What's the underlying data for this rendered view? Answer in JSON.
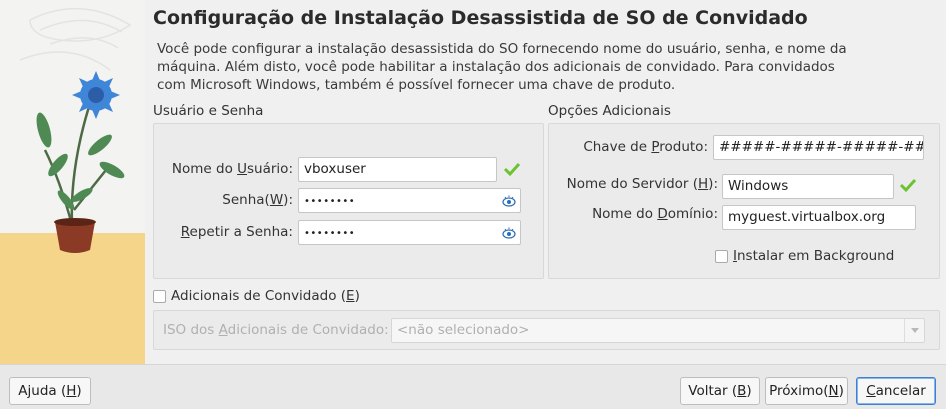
{
  "title": "Configuração de Instalação Desassistida de SO de Convidado",
  "description": "Você pode configurar a instalação desassistida do SO fornecendo nome do usuário, senha, e nome da máquina. Além disto, você pode habilitar a instalação dos adicionais de convidado. Para convidados com Microsoft Windows, também é possível fornecer uma chave de produto.",
  "user_group": {
    "title": "Usuário e Senha",
    "username_label_pre": "Nome do ",
    "username_label_u": "U",
    "username_label_post": "suário:",
    "username_value": "vboxuser",
    "password_label_pre": "Senha(",
    "password_label_u": "W",
    "password_label_post": "):",
    "password_value": "••••••••",
    "repeat_label_u": "R",
    "repeat_label_post": "epetir a Senha:",
    "repeat_value": "••••••••"
  },
  "options_group": {
    "title": "Opções Adicionais",
    "product_key_label_pre": "Chave de ",
    "product_key_label_u": "P",
    "product_key_label_post": "roduto:",
    "product_key_value": "#####-#####-#####-#####-#####",
    "hostname_label_pre": "Nome do Servidor (",
    "hostname_label_u": "H",
    "hostname_label_post": "):",
    "hostname_value": "Windows",
    "domain_label_pre": "Nome do ",
    "domain_label_u": "D",
    "domain_label_post": "omínio:",
    "domain_value": "myguest.virtualbox.org",
    "background_label_u": "I",
    "background_label_post": "nstalar em Background",
    "background_checked": false
  },
  "guest_additions": {
    "label_pre": "Adicionais de Convidado (",
    "label_u": "E",
    "label_post": ")",
    "checked": false,
    "iso_label_pre": "ISO dos ",
    "iso_label_u": "A",
    "iso_label_post": "dicionais de Convidado:",
    "iso_value": "<não selecionado>"
  },
  "buttons": {
    "help_pre": "Ajuda (",
    "help_u": "H",
    "help_post": ")",
    "back_pre": "Voltar (",
    "back_u": "B",
    "back_post": ")",
    "next_pre": "Próximo(",
    "next_u": "N",
    "next_post": ")",
    "cancel_u": "C",
    "cancel_post": "ancelar"
  },
  "colors": {
    "check_green": "#6cc330",
    "flower_blue": "#3f86d8",
    "table_yellow": "#f5d58a",
    "pot_brown": "#8a3a25"
  }
}
